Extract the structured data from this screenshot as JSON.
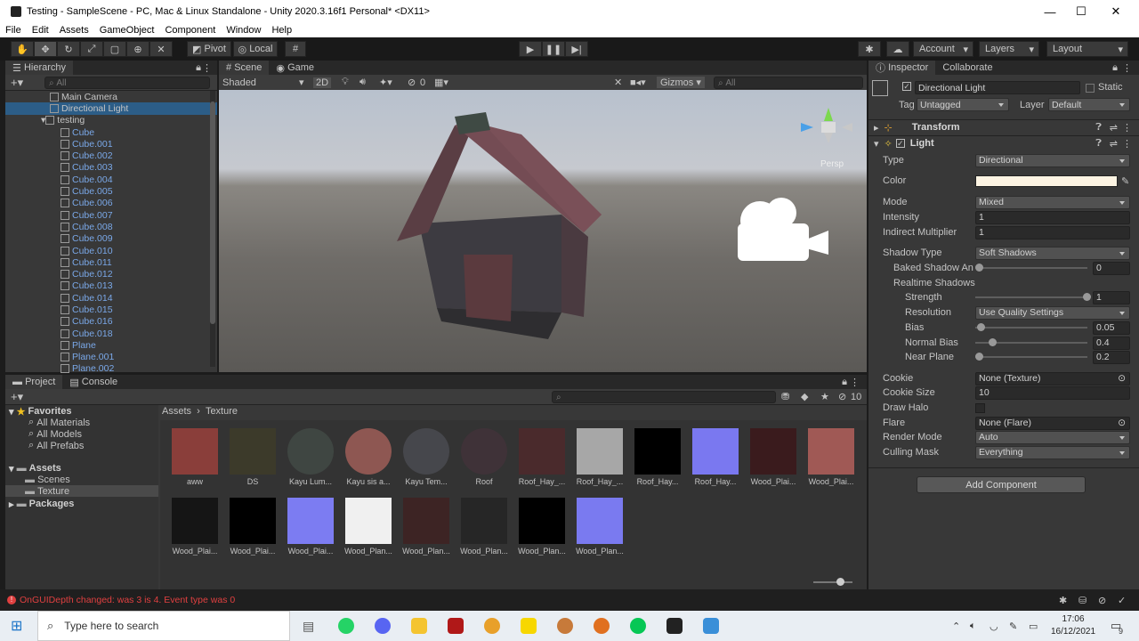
{
  "window": {
    "title": "Testing - SampleScene - PC, Mac & Linux Standalone - Unity 2020.3.16f1 Personal* <DX11>"
  },
  "menu": [
    "File",
    "Edit",
    "Assets",
    "GameObject",
    "Component",
    "Window",
    "Help"
  ],
  "toolbar": {
    "pivot": "Pivot",
    "local": "Local",
    "account": "Account",
    "layers": "Layers",
    "layout": "Layout"
  },
  "hierarchy": {
    "tab": "Hierarchy",
    "search": "All",
    "items": [
      {
        "label": "Main Camera"
      },
      {
        "label": "Directional Light"
      },
      {
        "label": "testing"
      },
      {
        "label": "Cube"
      },
      {
        "label": "Cube.001"
      },
      {
        "label": "Cube.002"
      },
      {
        "label": "Cube.003"
      },
      {
        "label": "Cube.004"
      },
      {
        "label": "Cube.005"
      },
      {
        "label": "Cube.006"
      },
      {
        "label": "Cube.007"
      },
      {
        "label": "Cube.008"
      },
      {
        "label": "Cube.009"
      },
      {
        "label": "Cube.010"
      },
      {
        "label": "Cube.011"
      },
      {
        "label": "Cube.012"
      },
      {
        "label": "Cube.013"
      },
      {
        "label": "Cube.014"
      },
      {
        "label": "Cube.015"
      },
      {
        "label": "Cube.016"
      },
      {
        "label": "Cube.018"
      },
      {
        "label": "Plane"
      },
      {
        "label": "Plane.001"
      },
      {
        "label": "Plane.002"
      }
    ]
  },
  "scene": {
    "tabs": [
      "Scene",
      "Game"
    ],
    "shading": "Shaded",
    "mode2d": "2D",
    "hidden_count": "0",
    "gizmos": "Gizmos",
    "search": "All",
    "persp": "Persp"
  },
  "inspector": {
    "tabs": [
      "Inspector",
      "Collaborate"
    ],
    "object_name": "Directional Light",
    "static": "Static",
    "tag_label": "Tag",
    "tag": "Untagged",
    "layer_label": "Layer",
    "layer": "Default",
    "transform": "Transform",
    "light": "Light",
    "type_label": "Type",
    "type": "Directional",
    "color_label": "Color",
    "color": "#fdf4e3",
    "mode_label": "Mode",
    "mode": "Mixed",
    "intensity_label": "Intensity",
    "intensity": "1",
    "indirect_label": "Indirect Multiplier",
    "indirect": "1",
    "shadow_type_label": "Shadow Type",
    "shadow_type": "Soft Shadows",
    "baked_label": "Baked Shadow An",
    "baked": "0",
    "realtime_label": "Realtime Shadows",
    "strength_label": "Strength",
    "strength": "1",
    "resolution_label": "Resolution",
    "resolution": "Use Quality Settings",
    "bias_label": "Bias",
    "bias": "0.05",
    "normal_bias_label": "Normal Bias",
    "normal_bias": "0.4",
    "near_plane_label": "Near Plane",
    "near_plane": "0.2",
    "cookie_label": "Cookie",
    "cookie": "None (Texture)",
    "cookie_size_label": "Cookie Size",
    "cookie_size": "10",
    "draw_halo_label": "Draw Halo",
    "flare_label": "Flare",
    "flare": "None (Flare)",
    "render_mode_label": "Render Mode",
    "render_mode": "Auto",
    "culling_label": "Culling Mask",
    "culling": "Everything",
    "add_component": "Add Component"
  },
  "project": {
    "tabs": [
      "Project",
      "Console"
    ],
    "favorites": "Favorites",
    "fav_items": [
      "All Materials",
      "All Models",
      "All Prefabs"
    ],
    "assets": "Assets",
    "asset_items": [
      "Scenes",
      "Texture"
    ],
    "packages": "Packages",
    "breadcrumb_root": "Assets",
    "breadcrumb_leaf": "Texture",
    "count": "10",
    "thumbs": [
      {
        "label": "aww",
        "color": "#8a3e3a"
      },
      {
        "label": "DS",
        "color": "#3c3a2a"
      },
      {
        "label": "Kayu Lum...",
        "color": "#3f4642"
      },
      {
        "label": "Kayu sis a...",
        "color": "#8e5752"
      },
      {
        "label": "Kayu Tem...",
        "color": "#46474c"
      },
      {
        "label": "Roof",
        "color": "#3f3238"
      },
      {
        "label": "Roof_Hay_...",
        "color": "#4a2a2c"
      },
      {
        "label": "Roof_Hay_...",
        "color": "#a7a7a7"
      },
      {
        "label": "Roof_Hay...",
        "color": "#000000"
      },
      {
        "label": "Roof_Hay...",
        "color": "#7a78f0"
      },
      {
        "label": "Wood_Plai...",
        "color": "#3a1b1d"
      },
      {
        "label": "Wood_Plai...",
        "color": "#a05955"
      },
      {
        "label": "Wood_Plai...",
        "color": "#151515"
      },
      {
        "label": "Wood_Plai...",
        "color": "#000000"
      },
      {
        "label": "Wood_Plai...",
        "color": "#7c7cf2"
      },
      {
        "label": "Wood_Plan...",
        "color": "#f0f0f0"
      },
      {
        "label": "Wood_Plan...",
        "color": "#3d2424"
      },
      {
        "label": "Wood_Plan...",
        "color": "#262626"
      },
      {
        "label": "Wood_Plan...",
        "color": "#000000"
      },
      {
        "label": "Wood_Plan...",
        "color": "#7a7af0"
      }
    ]
  },
  "status": {
    "message": "OnGUIDepth changed: was 3 is 4. Event type was 0"
  },
  "taskbar": {
    "search": "Type here to search",
    "time": "17:06",
    "date": "16/12/2021",
    "badge": "9"
  }
}
